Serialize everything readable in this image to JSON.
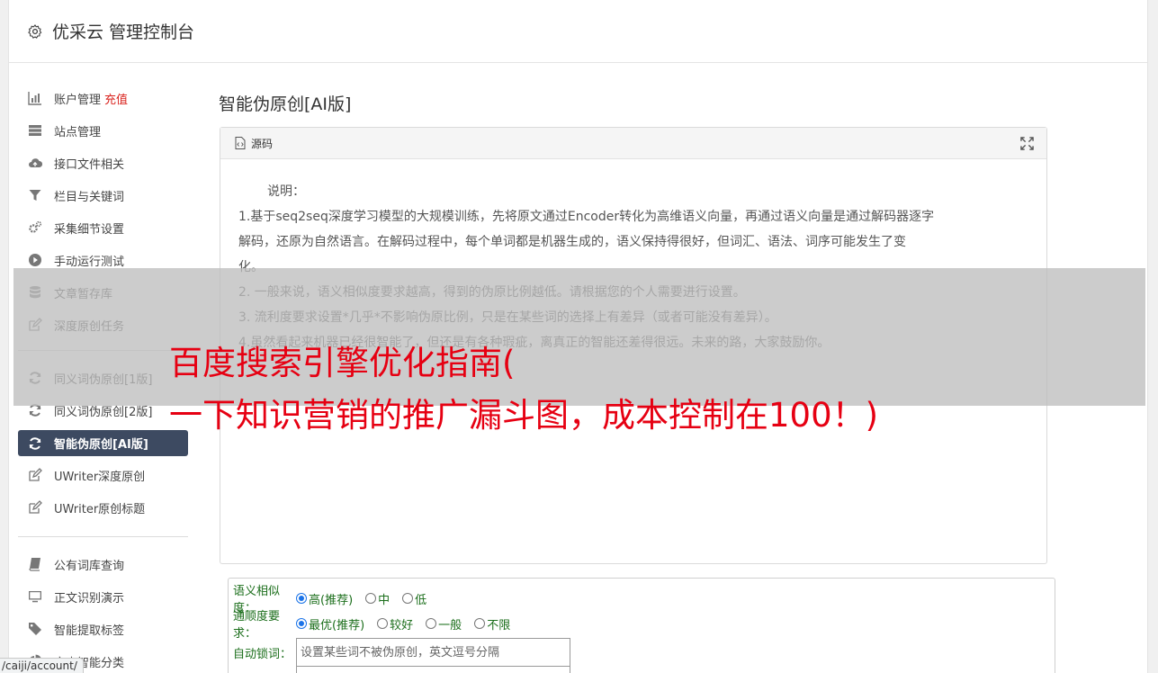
{
  "app": {
    "title": "优采云 管理控制台"
  },
  "sidebar": {
    "group1": [
      {
        "label": "账户管理",
        "badge": "充值",
        "icon": "bar-chart-icon"
      },
      {
        "label": "站点管理",
        "icon": "server-icon"
      },
      {
        "label": "接口文件相关",
        "icon": "cloud-upload-icon"
      },
      {
        "label": "栏目与关键词",
        "icon": "filter-icon"
      },
      {
        "label": "采集细节设置",
        "icon": "cogs-icon"
      },
      {
        "label": "手动运行测试",
        "icon": "play-circle-icon"
      },
      {
        "label": "文章暂存库",
        "icon": "database-icon"
      },
      {
        "label": "深度原创任务",
        "icon": "edit-icon"
      }
    ],
    "group2": [
      {
        "label": "同义词伪原创[1版]",
        "icon": "refresh-icon"
      },
      {
        "label": "同义词伪原创[2版]",
        "icon": "refresh-icon"
      },
      {
        "label": "智能伪原创[AI版]",
        "icon": "refresh-icon",
        "active": true
      },
      {
        "label": "UWriter深度原创",
        "icon": "edit-icon"
      },
      {
        "label": "UWriter原创标题",
        "icon": "edit-icon"
      }
    ],
    "group3": [
      {
        "label": "公有词库查询",
        "icon": "book-icon"
      },
      {
        "label": "正文识别演示",
        "icon": "monitor-icon"
      },
      {
        "label": "智能提取标签",
        "icon": "tag-icon"
      },
      {
        "label": "文本智能分类",
        "icon": "pie-chart-icon"
      }
    ]
  },
  "main": {
    "title": "智能伪原创[AI版]",
    "panel": {
      "header": "源码",
      "intro": "说明：",
      "lines": [
        "1.基于seq2seq深度学习模型的大规模训练，先将原文通过Encoder转化为高维语义向量，再通过语义向量是通过解码器逐字",
        "解码，还原为自然语言。在解码过程中，每个单词都是机器生成的，语义保持得很好，但词汇、语法、词序可能发生了变",
        "化。",
        "2. 一般来说，语义相似度要求越高，得到的伪原比例越低。请根据您的个人需要进行设置。",
        "3. 流利度要求设置*几乎*不影响伪原比例，只是在某些词的选择上有差异（或者可能没有差异）。",
        "4.虽然看起来机器已经很智能了，但还是有各种瑕疵，离真正的智能还差得很远。未来的路，大家鼓励你。"
      ]
    },
    "form": {
      "similarity": {
        "label": "语义相似度：",
        "options": [
          "高(推荐)",
          "中",
          "低"
        ],
        "selected": 0
      },
      "fluency": {
        "label": "通顺度要求：",
        "options": [
          "最优(推荐)",
          "较好",
          "一般",
          "不限"
        ],
        "selected": 0
      },
      "lock": {
        "label": "自动锁词：",
        "placeholder": "设置某些词不被伪原创，英文逗号分隔"
      }
    }
  },
  "banner": {
    "line1": "百度搜索引擎优化指南(",
    "line2": "一下知识营销的推广漏斗图，成本控制在100！)"
  },
  "statusbar": {
    "url": "/caiji/account/"
  },
  "colors": {
    "accent": "#3d4a61",
    "recharge": "#d9231e",
    "banner": "#e60012",
    "form_label": "#1b6e1b"
  }
}
